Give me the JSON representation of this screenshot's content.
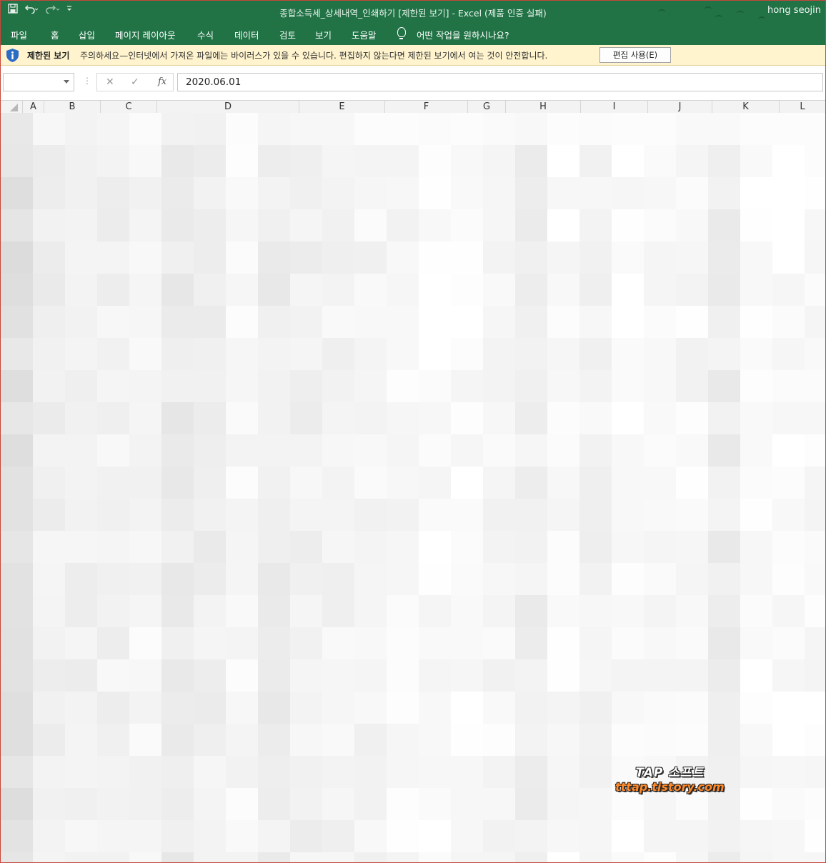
{
  "window": {
    "title": "종합소득세_상세내역_인쇄하기  [제한된 보기]  -  Excel (제품 인증 실패)",
    "user": "hong seojin"
  },
  "quick_access": {
    "save_icon": "save-icon",
    "undo_icon": "undo-icon",
    "redo_icon": "redo-icon",
    "customize_icon": "customize-icon"
  },
  "ribbon": {
    "tabs": [
      "파일",
      "홈",
      "삽입",
      "페이지 레이아웃",
      "수식",
      "데이터",
      "검토",
      "보기",
      "도움말"
    ],
    "tell_me": "어떤 작업을 원하시나요?"
  },
  "message_bar": {
    "title": "제한된 보기",
    "text": "주의하세요—인터넷에서 가져온 파일에는 바이러스가 있을 수 있습니다. 편집하지 않는다면 제한된 보기에서 여는 것이 안전합니다.",
    "button": "편집 사용(E)"
  },
  "formula_bar": {
    "name_box": "",
    "cancel_symbol": "✕",
    "enter_symbol": "✓",
    "fx_symbol": "fx",
    "value": "2020.06.01"
  },
  "columns": [
    "A",
    "B",
    "C",
    "D",
    "E",
    "F",
    "G",
    "H",
    "I",
    "J",
    "K",
    "L"
  ],
  "watermark": {
    "line1": "TAP 소프트",
    "line2": "tttap.tistory.com"
  },
  "colors": {
    "excel_green": "#217346",
    "message_bar": "#fff4ce"
  }
}
